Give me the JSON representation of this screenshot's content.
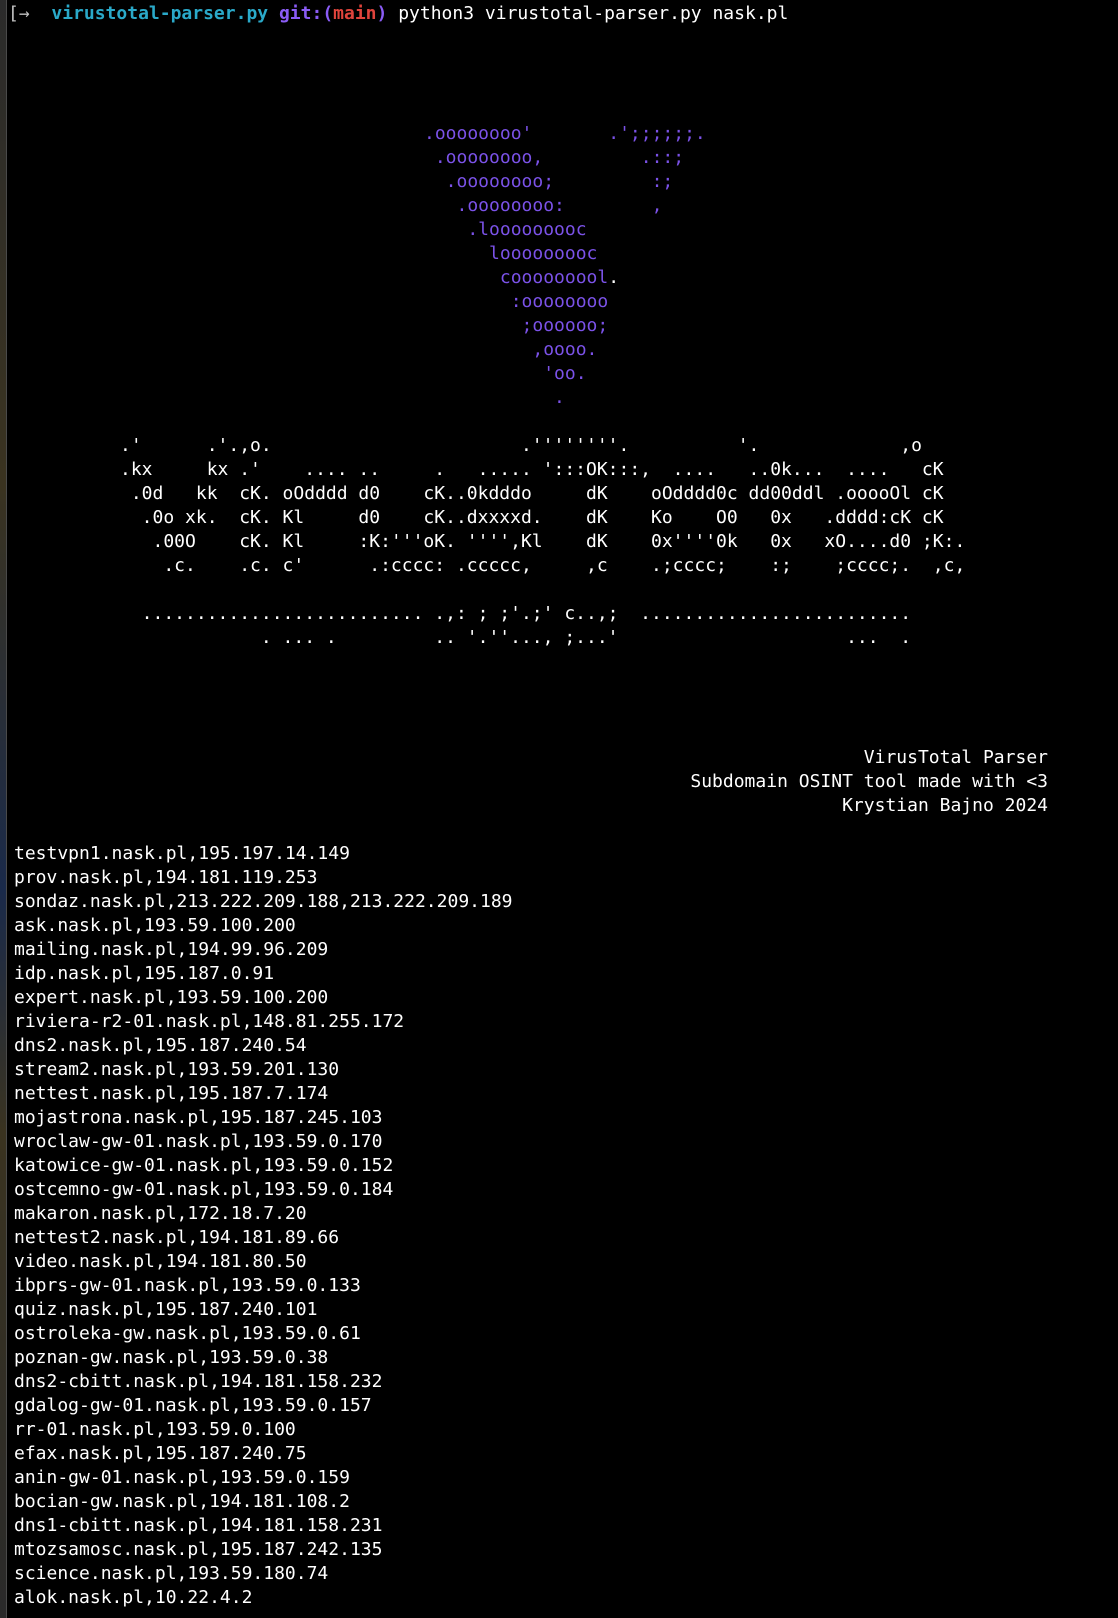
{
  "terminal": {
    "prompt": {
      "arrow": "[→",
      "directory": "virustotal-parser.py",
      "git_label": "git:(",
      "branch": "main",
      "git_close": ")",
      "command": "python3 virustotal-parser.py nask.pl"
    },
    "ascii_logo": [
      ".oooooooo'       .';;;;;;.",
      " .oooooooo,         .::;",
      "  .oooooooo;         :;",
      "   .oooooooo:        ,",
      "    .looooooooc",
      "      looooooooc",
      "       cooooooool.",
      "        :oooooooo",
      "         ;oooooo;",
      "          ,oooo.",
      "           'oo.",
      "            ."
    ],
    "ascii_banner": [
      ".'      .'.,o.                       .''''''''.          '.             ,o",
      ".kx     kx .'    .... ..     .   ..... ':::OK:::,  ....   ..0k...  ....   cK",
      " .0d   kk  cK. oOdddd d0    cK..0kdddo     dK    oOdddd0c dd00ddl .ooooOl cK",
      "  .0o xk.  cK. Kl     d0    cK..dxxxxd.    dK    Ko    O0   0x   .dddd:cK cK",
      "   .00O    cK. Kl     :K:'''oK. '''',Kl    dK    0x''''0k   0x   xO....d0 ;K:.",
      "    .c.    .c. c'      .:cccc: .ccccc,     ,c    .;cccc;    :;    ;cccc;.  ,c,"
    ],
    "ascii_dots": [
      "  .......................... .,: ; ;'.;' c..,;  .........................",
      "             . ... .         .. '.''..., ;...'                     ...  ."
    ],
    "credits": [
      "VirusTotal Parser",
      "Subdomain OSINT tool made with <3",
      "Krystian Bajno 2024"
    ],
    "results": [
      "testvpn1.nask.pl,195.197.14.149",
      "prov.nask.pl,194.181.119.253",
      "sondaz.nask.pl,213.222.209.188,213.222.209.189",
      "ask.nask.pl,193.59.100.200",
      "mailing.nask.pl,194.99.96.209",
      "idp.nask.pl,195.187.0.91",
      "expert.nask.pl,193.59.100.200",
      "riviera-r2-01.nask.pl,148.81.255.172",
      "dns2.nask.pl,195.187.240.54",
      "stream2.nask.pl,193.59.201.130",
      "nettest.nask.pl,195.187.7.174",
      "mojastrona.nask.pl,195.187.245.103",
      "wroclaw-gw-01.nask.pl,193.59.0.170",
      "katowice-gw-01.nask.pl,193.59.0.152",
      "ostcemno-gw-01.nask.pl,193.59.0.184",
      "makaron.nask.pl,172.18.7.20",
      "nettest2.nask.pl,194.181.89.66",
      "video.nask.pl,194.181.80.50",
      "ibprs-gw-01.nask.pl,193.59.0.133",
      "quiz.nask.pl,195.187.240.101",
      "ostroleka-gw.nask.pl,193.59.0.61",
      "poznan-gw.nask.pl,193.59.0.38",
      "dns2-cbitt.nask.pl,194.181.158.232",
      "gdalog-gw-01.nask.pl,193.59.0.157",
      "rr-01.nask.pl,193.59.0.100",
      "efax.nask.pl,195.187.240.75",
      "anin-gw-01.nask.pl,193.59.0.159",
      "bocian-gw.nask.pl,194.181.108.2",
      "dns1-cbitt.nask.pl,194.181.158.231",
      "mtozsamosc.nask.pl,195.187.242.135",
      "science.nask.pl,193.59.180.74",
      "alok.nask.pl,10.22.4.2"
    ],
    "colors": {
      "background": "#000000",
      "directory": "#2aa9c9",
      "git": "#8a5cf5",
      "branch": "#e0443c",
      "logo": "#7b52e8",
      "text": "#ffffff"
    }
  }
}
